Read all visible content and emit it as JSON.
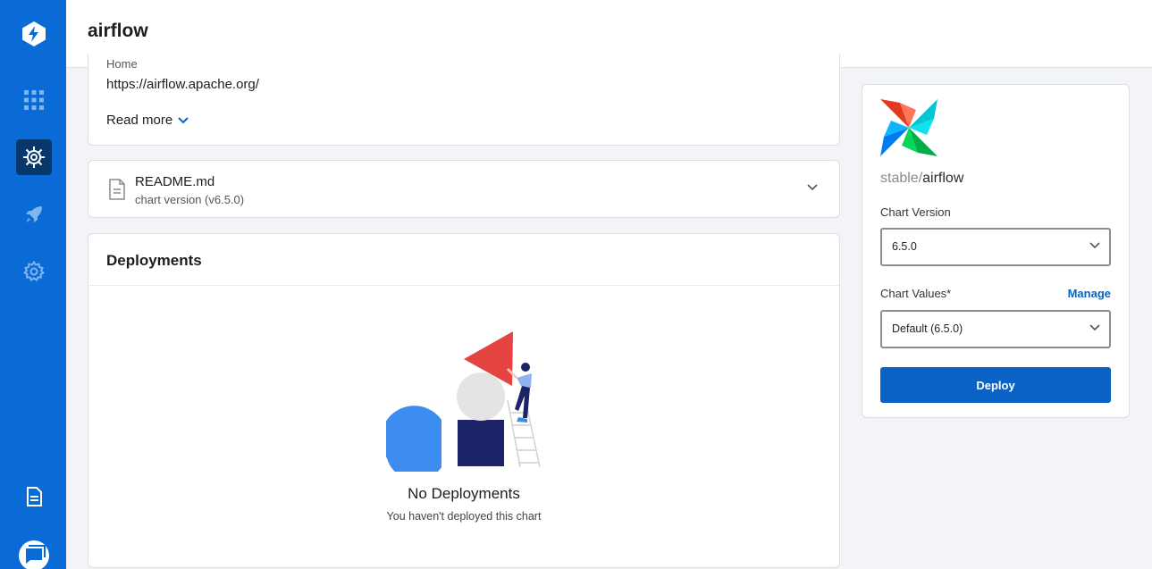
{
  "header": {
    "title": "airflow"
  },
  "sidebar": {
    "items": [
      {
        "icon": "logo-icon"
      },
      {
        "icon": "apps-grid-icon"
      },
      {
        "icon": "helm-wheel-icon",
        "active": true
      },
      {
        "icon": "rocket-icon"
      },
      {
        "icon": "gear-icon"
      },
      {
        "icon": "document-icon"
      },
      {
        "icon": "chat-icon"
      }
    ]
  },
  "about": {
    "home_label": "Home",
    "home_url": "https://airflow.apache.org/",
    "read_more": "Read more"
  },
  "readme": {
    "file_name": "README.md",
    "chart_version": "chart version (v6.5.0)"
  },
  "deployments": {
    "title": "Deployments",
    "empty_title": "No Deployments",
    "empty_subtitle": "You haven't deployed this chart"
  },
  "chart": {
    "repo": "stable/",
    "name": "airflow",
    "version_label": "Chart Version",
    "version_value": "6.5.0",
    "values_label": "Chart Values*",
    "manage_label": "Manage",
    "values_value": "Default (6.5.0)",
    "deploy_label": "Deploy"
  },
  "colors": {
    "sidebar": "#0a6bd6",
    "primary": "#0a62c4",
    "active_nav": "#08386b"
  }
}
